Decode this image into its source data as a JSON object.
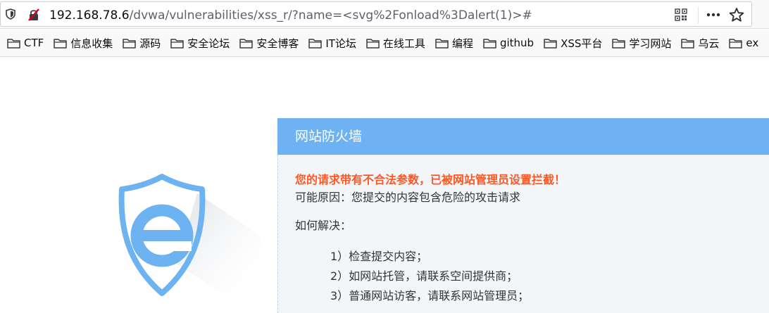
{
  "browser": {
    "url_host": "192.168.78.6",
    "url_path": "/dvwa/vulnerabilities/xss_r/?name=<svg%2Fonload%3Dalert(1)>#",
    "icons": [
      "shield-icon",
      "insecure-lock-icon",
      "qr-code-icon",
      "more-dots-icon",
      "star-icon"
    ]
  },
  "bookmarks": [
    {
      "label": "CTF"
    },
    {
      "label": "信息收集"
    },
    {
      "label": "源码"
    },
    {
      "label": "安全论坛"
    },
    {
      "label": "安全博客"
    },
    {
      "label": "IT论坛"
    },
    {
      "label": "在线工具"
    },
    {
      "label": "编程"
    },
    {
      "label": "github"
    },
    {
      "label": "XSS平台"
    },
    {
      "label": "学习网站"
    },
    {
      "label": "乌云"
    },
    {
      "label": "ex"
    }
  ],
  "firewall": {
    "title": "网站防火墙",
    "warning": "您的请求带有不合法参数，已被网站管理员设置拦截！",
    "reason": "可能原因：您提交的内容包含危险的攻击请求",
    "howto": "如何解决：",
    "steps": [
      "1）检查提交内容；",
      "2）如网站托管，请联系空间提供商；",
      "3）普通网站访客，请联系网站管理员；"
    ]
  },
  "colors": {
    "header_blue": "#6eb2f4",
    "warning_orange": "#ff5722",
    "shield_blue": "#6db3f2",
    "body_bg": "#f2f6f9"
  }
}
